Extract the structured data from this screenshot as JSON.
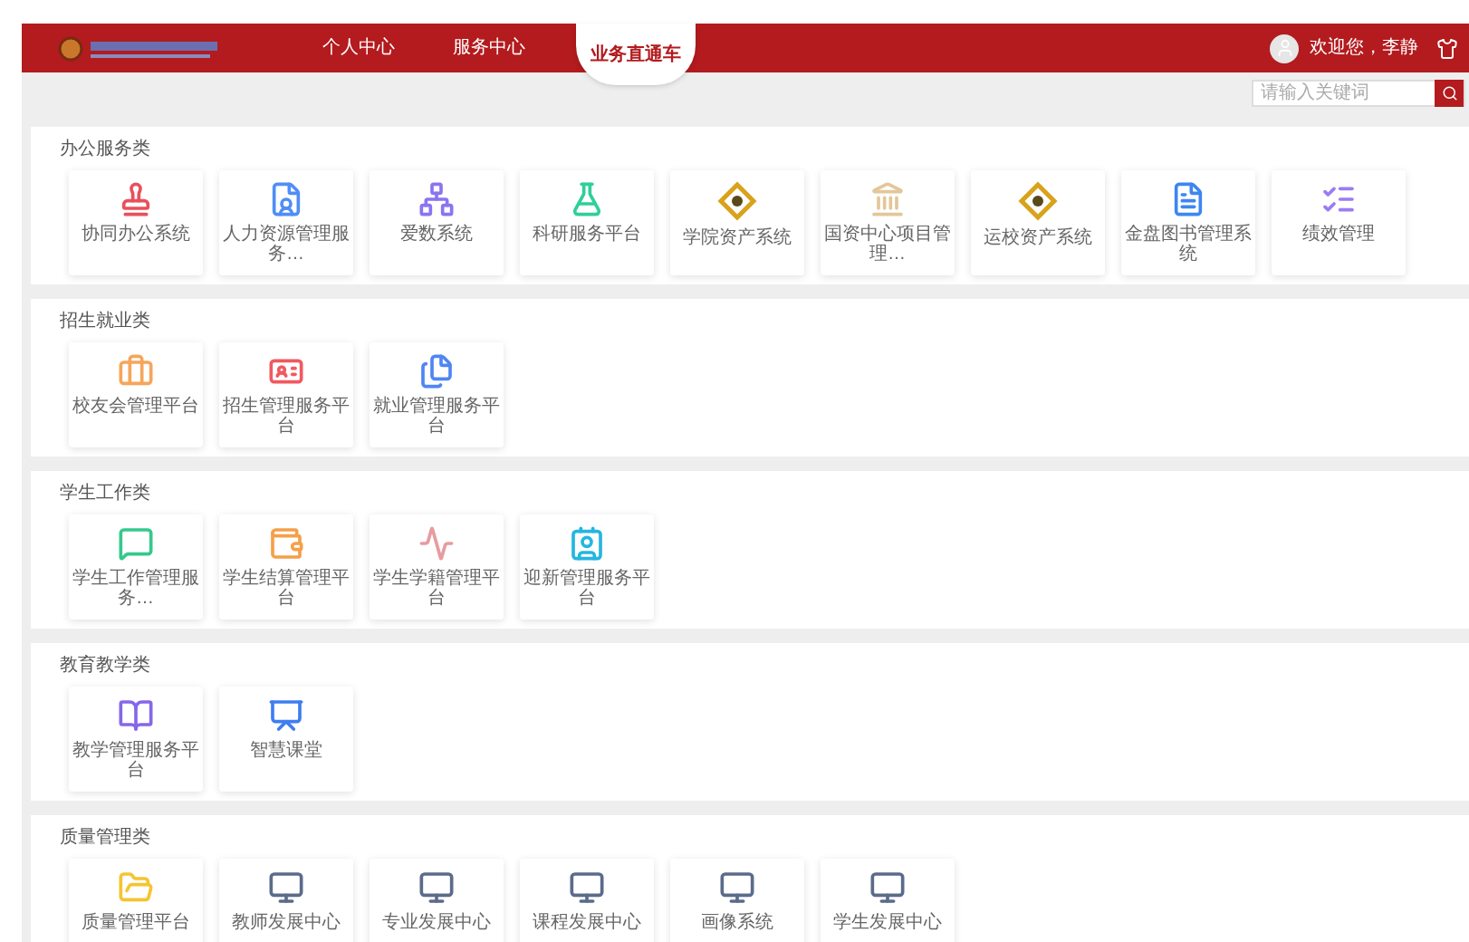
{
  "header": {
    "nav": [
      {
        "label": "个人中心",
        "selected": false
      },
      {
        "label": "服务中心",
        "selected": false
      },
      {
        "label": "业务直通车",
        "selected": true
      }
    ],
    "user": {
      "greeting": "欢迎您，李静"
    }
  },
  "search": {
    "placeholder": "请输入关键词"
  },
  "sections": [
    {
      "title": "办公服务类",
      "apps": [
        "协同办公系统",
        "人力资源管理服务…",
        "爱数系统",
        "科研服务平台",
        "学院资产系统",
        "国资中心项目管理…",
        "运校资产系统",
        "金盘图书管理系统",
        "绩效管理"
      ]
    },
    {
      "title": "招生就业类",
      "apps": [
        "校友会管理平台",
        "招生管理服务平台",
        "就业管理服务平台"
      ]
    },
    {
      "title": "学生工作类",
      "apps": [
        "学生工作管理服务…",
        "学生结算管理平台",
        "学生学籍管理平台",
        "迎新管理服务平台"
      ]
    },
    {
      "title": "教育教学类",
      "apps": [
        "教学管理服务平台",
        "智慧课堂"
      ]
    },
    {
      "title": "质量管理类",
      "apps": [
        "质量管理平台",
        "教师发展中心",
        "专业发展中心",
        "课程发展中心",
        "画像系统",
        "学生发展中心"
      ]
    }
  ]
}
